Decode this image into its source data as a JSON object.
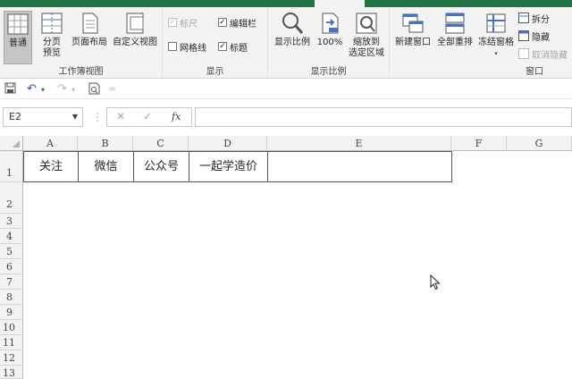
{
  "ribbon": {
    "workbook_views": {
      "label": "工作簿视图",
      "normal": "普通",
      "page_break_line1": "分页",
      "page_break_line2": "预览",
      "page_layout": "页面布局",
      "custom_views": "自定义视图"
    },
    "show": {
      "label": "显示",
      "ruler": "标尺",
      "formula_bar": "编辑栏",
      "gridlines": "网格线",
      "headings": "标题"
    },
    "zoom": {
      "label": "显示比例",
      "zoom": "显示比例",
      "hundred": "100%",
      "zoom_sel_line1": "缩放到",
      "zoom_sel_line2": "选定区域"
    },
    "window": {
      "label": "窗口",
      "new_window": "新建窗口",
      "arrange_all": "全部重排",
      "freeze_panes": "冻结窗格",
      "split": "拆分",
      "hide": "隐藏",
      "unhide": "取消隐藏"
    }
  },
  "formula_bar": {
    "name_box": "E2",
    "fx": "fx",
    "value": ""
  },
  "sheet": {
    "columns": [
      "A",
      "B",
      "C",
      "D",
      "E",
      "F",
      "G"
    ],
    "rows": [
      "1",
      "2",
      "3",
      "4",
      "5",
      "6",
      "7",
      "8",
      "9",
      "10",
      "11",
      "12",
      "13"
    ],
    "row1": [
      "关注",
      "微信",
      "公众号",
      "一起学造价",
      ""
    ]
  },
  "colors": {
    "accent": "#217346",
    "ribbon_bg": "#f3f3f3"
  }
}
